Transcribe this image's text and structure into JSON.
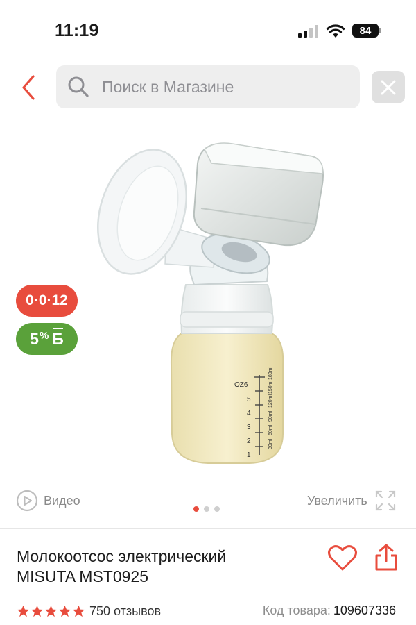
{
  "status_bar": {
    "time": "11:19",
    "battery": "84"
  },
  "header": {
    "search_placeholder": "Поиск в Магазине",
    "icons": [
      "chevron-left-icon",
      "search-icon",
      "close-icon"
    ]
  },
  "badges": {
    "installment": "0·0·12",
    "bonus_percent": "5",
    "bonus_sign": "%",
    "bonus_letter": "Б"
  },
  "gallery": {
    "video_label": "Видео",
    "zoom_label": "Увеличить",
    "dots_total": 3,
    "dot_active": 1,
    "bottle_marks": {
      "oz_label": "OZ6",
      "oz": [
        "5",
        "4",
        "3",
        "2",
        "1"
      ],
      "ml": [
        "180ml",
        "150ml",
        "120ml",
        "90ml",
        "60ml",
        "30ml"
      ]
    }
  },
  "product": {
    "title_line1": "Молокоотсос электрический",
    "title_line2": "MISUTA MST0925",
    "rating": 5,
    "reviews": "750 отзывов",
    "code_label": "Код товара:",
    "code_value": "109607336"
  },
  "colors": {
    "accent": "#e84c3d",
    "bonus": "#5aa13a",
    "search_bg": "#eeeeee"
  }
}
